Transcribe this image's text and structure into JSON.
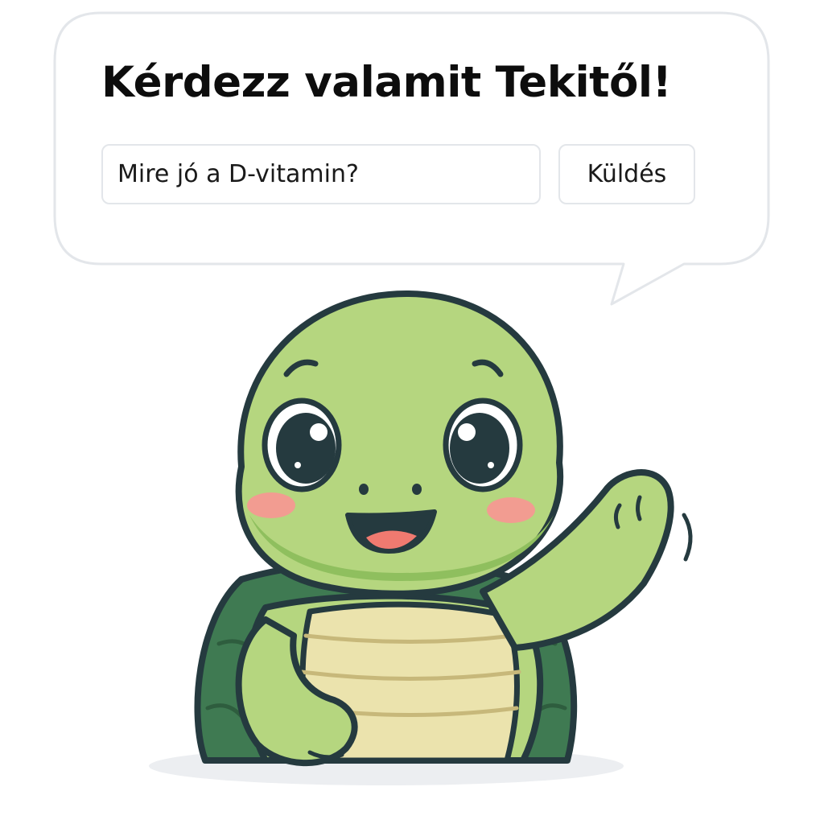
{
  "prompt": {
    "title": "Kérdezz valamit Tekitől!",
    "input_value": "Mire jó a D-vitamin?",
    "send_label": "Küldés"
  },
  "mascot": {
    "icon": "waving-turtle-icon"
  },
  "colors": {
    "skin": "#b5d67f",
    "skin_shadow": "#8fbf5e",
    "shell": "#3f7a52",
    "belly": "#ebe3ad",
    "outline": "#253a3f",
    "cheek": "#f29c91",
    "bubble_border": "#e3e6ea"
  }
}
